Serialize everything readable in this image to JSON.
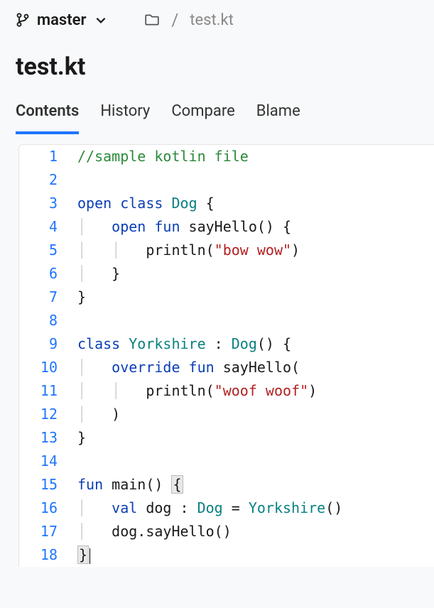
{
  "header": {
    "branch": "master",
    "breadcrumb_sep": "/",
    "breadcrumb_file": "test.kt"
  },
  "title": "test.kt",
  "tabs": {
    "contents": "Contents",
    "history": "History",
    "compare": "Compare",
    "blame": "Blame"
  },
  "code": {
    "lines": [
      {
        "n": "1",
        "tokens": [
          [
            "comment",
            "//sample kotlin file"
          ]
        ]
      },
      {
        "n": "2",
        "tokens": []
      },
      {
        "n": "3",
        "tokens": [
          [
            "keyword",
            "open"
          ],
          [
            "ident",
            " "
          ],
          [
            "keyword",
            "class"
          ],
          [
            "ident",
            " "
          ],
          [
            "class",
            "Dog"
          ],
          [
            "ident",
            " {"
          ]
        ]
      },
      {
        "n": "4",
        "tokens": [
          [
            "guide",
            "│   "
          ],
          [
            "keyword",
            "open"
          ],
          [
            "ident",
            " "
          ],
          [
            "keyword",
            "fun"
          ],
          [
            "ident",
            " sayHello() {"
          ]
        ]
      },
      {
        "n": "5",
        "tokens": [
          [
            "guide",
            "│   │   "
          ],
          [
            "ident",
            "println("
          ],
          [
            "string",
            "\"bow wow\""
          ],
          [
            "ident",
            ")"
          ]
        ]
      },
      {
        "n": "6",
        "tokens": [
          [
            "guide",
            "│   "
          ],
          [
            "ident",
            "}"
          ]
        ]
      },
      {
        "n": "7",
        "tokens": [
          [
            "ident",
            "}"
          ]
        ]
      },
      {
        "n": "8",
        "tokens": []
      },
      {
        "n": "9",
        "tokens": [
          [
            "keyword",
            "class"
          ],
          [
            "ident",
            " "
          ],
          [
            "class",
            "Yorkshire"
          ],
          [
            "ident",
            " : "
          ],
          [
            "class",
            "Dog"
          ],
          [
            "ident",
            "() {"
          ]
        ]
      },
      {
        "n": "10",
        "tokens": [
          [
            "guide",
            "│   "
          ],
          [
            "keyword",
            "override"
          ],
          [
            "ident",
            " "
          ],
          [
            "keyword",
            "fun"
          ],
          [
            "ident",
            " sayHello("
          ]
        ]
      },
      {
        "n": "11",
        "tokens": [
          [
            "guide",
            "│   │   "
          ],
          [
            "ident",
            "println("
          ],
          [
            "string",
            "\"woof woof\""
          ],
          [
            "ident",
            ")"
          ]
        ]
      },
      {
        "n": "12",
        "tokens": [
          [
            "guide",
            "│   "
          ],
          [
            "ident",
            ")"
          ]
        ]
      },
      {
        "n": "13",
        "tokens": [
          [
            "ident",
            "}"
          ]
        ]
      },
      {
        "n": "14",
        "tokens": []
      },
      {
        "n": "15",
        "tokens": [
          [
            "keyword",
            "fun"
          ],
          [
            "ident",
            " main() "
          ],
          [
            "bracket",
            "{"
          ]
        ]
      },
      {
        "n": "16",
        "tokens": [
          [
            "guide",
            "│   "
          ],
          [
            "keyword",
            "val"
          ],
          [
            "ident",
            " dog : "
          ],
          [
            "class",
            "Dog"
          ],
          [
            "ident",
            " = "
          ],
          [
            "class",
            "Yorkshire"
          ],
          [
            "ident",
            "()"
          ]
        ]
      },
      {
        "n": "17",
        "tokens": [
          [
            "guide",
            "│   "
          ],
          [
            "ident",
            "dog.sayHello()"
          ]
        ]
      },
      {
        "n": "18",
        "tokens": [
          [
            "bracket",
            "}"
          ]
        ],
        "cursor": true
      }
    ]
  }
}
